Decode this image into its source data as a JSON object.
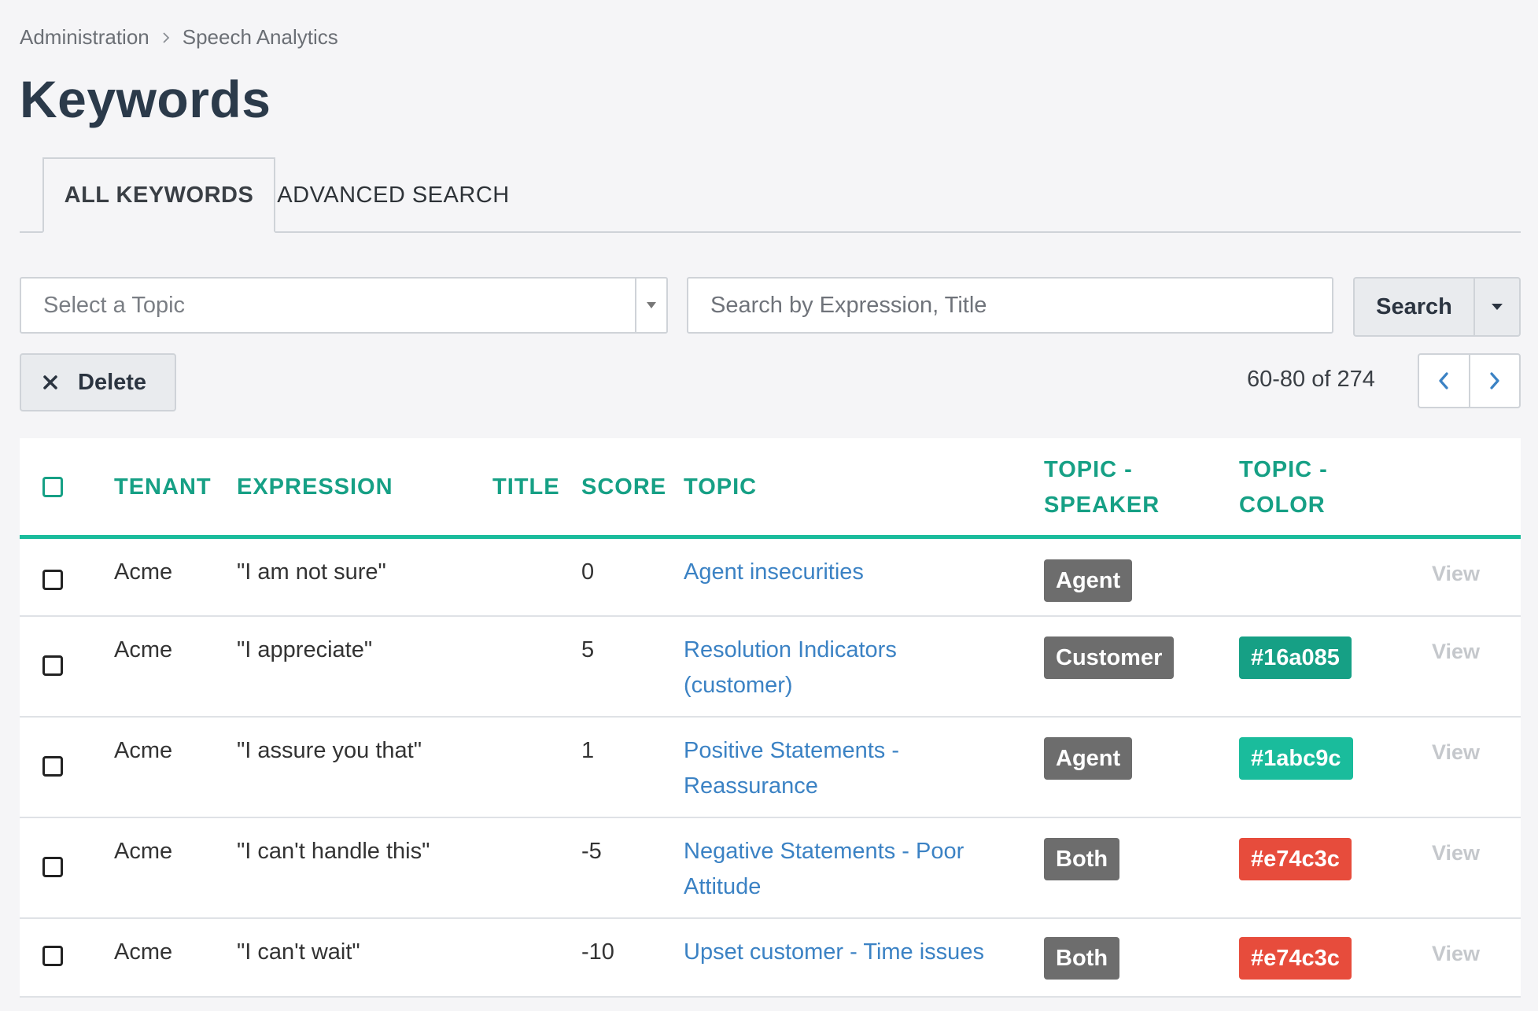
{
  "breadcrumb": {
    "items": [
      "Administration",
      "Speech Analytics"
    ]
  },
  "page": {
    "title": "Keywords"
  },
  "tabs": [
    {
      "label": "ALL KEYWORDS",
      "active": true
    },
    {
      "label": "ADVANCED SEARCH",
      "active": false
    }
  ],
  "filters": {
    "topic_placeholder": "Select a Topic",
    "search_placeholder": "Search by Expression, Title",
    "search_label": "Search"
  },
  "actions": {
    "delete_label": "Delete"
  },
  "pagination": {
    "range": "60-80 of 274"
  },
  "table": {
    "headers": {
      "tenant": "TENANT",
      "expression": "EXPRESSION",
      "title": "TITLE",
      "score": "SCORE",
      "topic": "TOPIC",
      "topic_speaker_1": "TOPIC -",
      "topic_speaker_2": "SPEAKER",
      "topic_color_1": "TOPIC -",
      "topic_color_2": "COLOR"
    },
    "rows": [
      {
        "tenant": "Acme",
        "expression": "\"I am not sure\"",
        "title": "",
        "score": "0",
        "topic_line1": "Agent insecurities",
        "topic_line2": "",
        "speaker": "Agent",
        "color": "",
        "view": "View"
      },
      {
        "tenant": "Acme",
        "expression": "\"I appreciate\"",
        "title": "",
        "score": "5",
        "topic_line1": "Resolution Indicators",
        "topic_line2": "(customer)",
        "speaker": "Customer",
        "color": "#16a085",
        "view": "View"
      },
      {
        "tenant": "Acme",
        "expression": "\"I assure you that\"",
        "title": "",
        "score": "1",
        "topic_line1": "Positive Statements -",
        "topic_line2": "Reassurance",
        "speaker": "Agent",
        "color": "#1abc9c",
        "view": "View"
      },
      {
        "tenant": "Acme",
        "expression": "\"I can't handle this\"",
        "title": "",
        "score": "-5",
        "topic_line1": "Negative Statements - Poor",
        "topic_line2": "Attitude",
        "speaker": "Both",
        "color": "#e74c3c",
        "view": "View"
      },
      {
        "tenant": "Acme",
        "expression": "\"I can't wait\"",
        "title": "",
        "score": "-10",
        "topic_line1": "Upset customer - Time issues",
        "topic_line2": "",
        "speaker": "Both",
        "color": "#e74c3c",
        "view": "View"
      }
    ]
  },
  "icons": {
    "breadcrumb_separator": "chevron-right-icon",
    "select_arrow": "triangle-down-icon",
    "search_dropdown": "caret-down-icon",
    "delete": "close-icon",
    "pager_prev": "chevron-left-icon",
    "pager_next": "chevron-right-icon"
  },
  "colors": {
    "accent": "#16a085",
    "accent_light": "#1abc9c",
    "link": "#3b82c4",
    "danger": "#e74c3c",
    "speaker_badge": "#6d6d6d"
  }
}
